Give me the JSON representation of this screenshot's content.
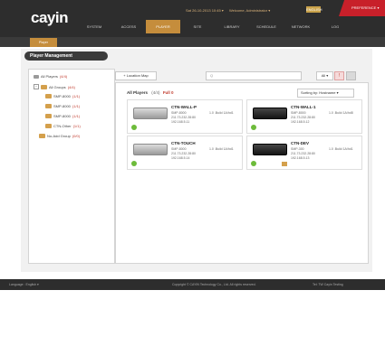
{
  "header": {
    "logo": "cayin",
    "top_links": [
      "Sat 26-10-2013 10:45 ▾",
      "Welcome, Administrator ▾"
    ],
    "language_button": "ENGLISH",
    "red_tab": "PREFERENCE ▾",
    "nav": [
      "SYSTEM",
      "ACCESS",
      "PLAYER",
      "SITE",
      "LIBRARY",
      "SCHEDULE",
      "NETWORK",
      "LOG"
    ],
    "active_nav": "PLAYER"
  },
  "subnav": {
    "active_tab": "Player Management"
  },
  "page": {
    "title": "Player Management"
  },
  "sidebar": {
    "all_players": {
      "label": "All Players",
      "count": "(4/4)"
    },
    "all_groups": {
      "label": "All Groups",
      "count": "(4/4)"
    },
    "groups": [
      {
        "label": "SMP-8000",
        "count": "(1/1)"
      },
      {
        "label": "SMP-8000",
        "count": "(1/1)"
      },
      {
        "label": "SMP-8000",
        "count": "(1/1)"
      },
      {
        "label": "CTN-Other",
        "count": "(1/1)"
      }
    ],
    "ungrouped": {
      "label": "No-Add Group",
      "count": "(0/0)"
    }
  },
  "toolbar": {
    "location_button": "+ Location Map",
    "search_placeholder": "Q",
    "view_select": "All ▾",
    "sort_select": "Sorting by: Hostname ▾"
  },
  "main": {
    "heading": "All Players",
    "subheading": "(4/4)",
    "flag": "Full 0",
    "cards": [
      {
        "name": "CTN-WALL-P",
        "model": "SMP-8000",
        "ip": "211.73.232.28:80",
        "serial": "192.168.5.11",
        "firmware": "1.0 .Build 1A/hd1",
        "device": "silver"
      },
      {
        "name": "CTN-WALL-1",
        "model": "SMP-8000",
        "ip": "211.73.232.28:80",
        "serial": "192.168.5.12",
        "firmware": "1.0 .Build 1A/hd8",
        "device": "black"
      },
      {
        "name": "CTN-TOUCH",
        "model": "SMP-8000",
        "ip": "211.73.232.28:80",
        "serial": "192.168.5.14",
        "firmware": "1.0 .Build 1A/hd1",
        "device": "silver"
      },
      {
        "name": "CTN-DEV",
        "model": "SMP-300",
        "ip": "211.73.232.28:80",
        "serial": "192.168.5.13",
        "firmware": "1.0 .Build 1A/hd1",
        "device": "black"
      }
    ]
  },
  "footer": {
    "language": "Language : English ▾",
    "copyright": "Copyright © CAYIN Technology Co., Ltd. All rights reserved.",
    "right": "Tel: TW Cayin Testing"
  },
  "colors": {
    "accent": "#c58d3c",
    "header": "#2d2d2d",
    "status_online": "#6dbb3a",
    "alert": "#c8202a"
  }
}
